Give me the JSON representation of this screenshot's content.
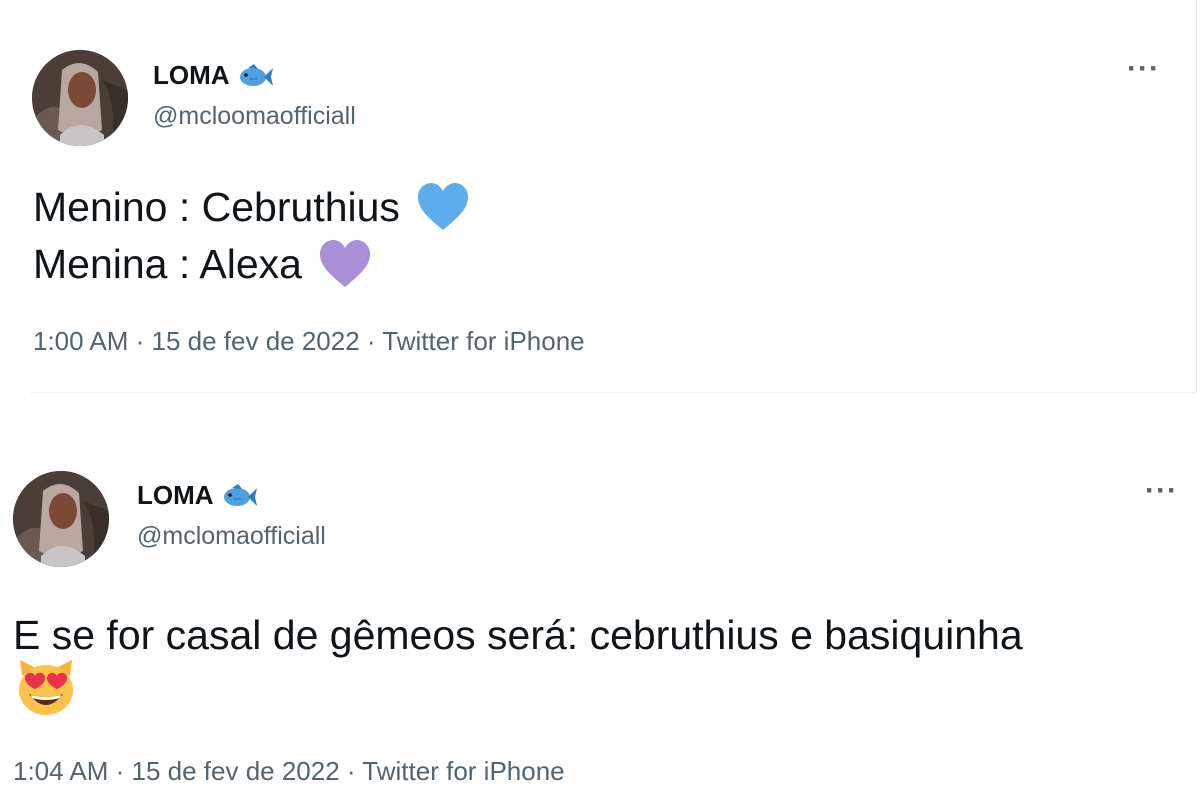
{
  "tweets": [
    {
      "name": "LOMA",
      "handle": "@mcloomaofficiall",
      "lines": [
        "Menino : Cebruthius",
        "Menina : Alexa"
      ],
      "meta": "1:00 AM · 15 de fev de 2022 · Twitter for iPhone",
      "more": "···",
      "icons": [
        "fish-emoji",
        "blue-heart-emoji",
        "purple-heart-emoji"
      ]
    },
    {
      "name": "LOMA",
      "handle": "@mclomaofficiall",
      "lines": [
        "E se for casal de gêmeos será: cebruthius e basiquinha"
      ],
      "meta": "1:04 AM · 15 de fev de 2022 · Twitter for iPhone",
      "more": "···",
      "icons": [
        "fish-emoji",
        "heart-eyes-cat-emoji"
      ]
    }
  ],
  "colors": {
    "text": "#0f1419",
    "secondary": "#536471",
    "blue_heart": "#5dadec",
    "purple_heart": "#aa8ed6"
  }
}
